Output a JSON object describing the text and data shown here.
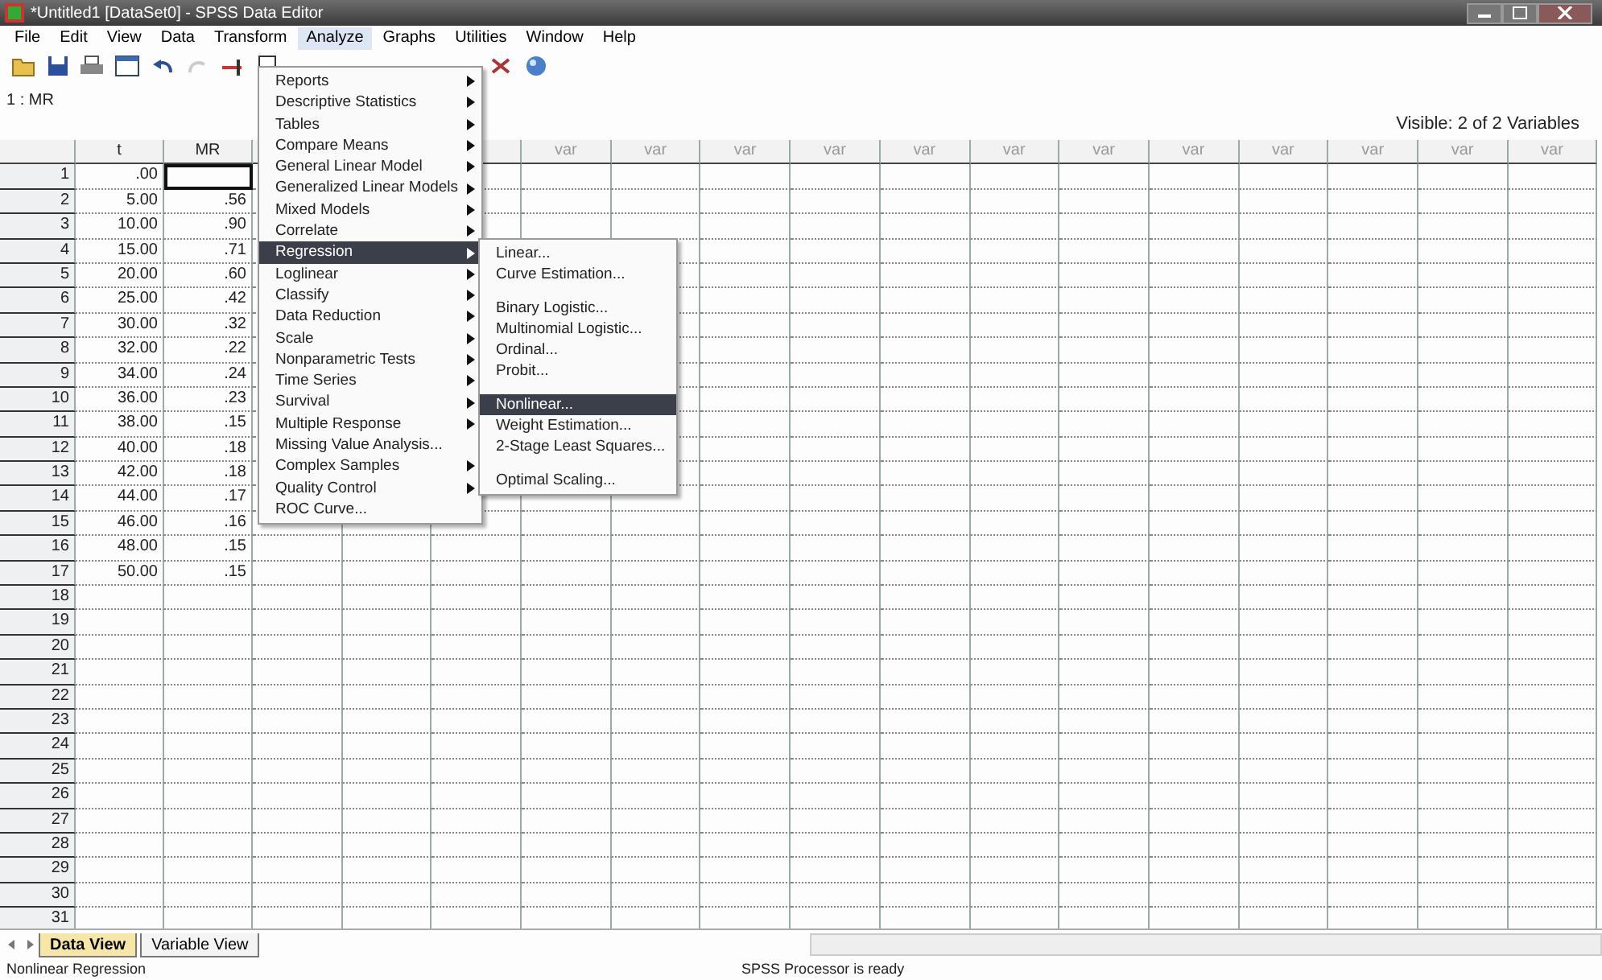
{
  "window": {
    "title": "*Untitled1 [DataSet0] - SPSS Data Editor"
  },
  "menu_bar": [
    {
      "label": "File",
      "selected": false
    },
    {
      "label": "Edit",
      "selected": false
    },
    {
      "label": "View",
      "selected": false
    },
    {
      "label": "Data",
      "selected": false
    },
    {
      "label": "Transform",
      "selected": false
    },
    {
      "label": "Analyze",
      "selected": true
    },
    {
      "label": "Graphs",
      "selected": false
    },
    {
      "label": "Utilities",
      "selected": false
    },
    {
      "label": "Window",
      "selected": false
    },
    {
      "label": "Help",
      "selected": false
    }
  ],
  "cell_editor": {
    "cell": "1 : MR"
  },
  "visible_count": "Visible: 2 of 2 Variables",
  "table": {
    "columns": [
      "t",
      "MR"
    ],
    "var_columns": [
      "var",
      "var",
      "var",
      "var",
      "var",
      "var",
      "var",
      "var",
      "var",
      "var",
      "var",
      "var"
    ],
    "rows": [
      {
        "number": "1",
        "values": [
          ".00"
        ],
        "active": true
      },
      {
        "number": "2",
        "values": [
          "5.00",
          ".56"
        ],
        "active": false
      },
      {
        "number": "3",
        "values": [
          "10.00",
          ".90"
        ],
        "active": false
      },
      {
        "number": "4",
        "values": [
          "15.00",
          ".71"
        ],
        "active": false
      },
      {
        "number": "5",
        "values": [
          "20.00",
          ".60"
        ],
        "active": false
      },
      {
        "number": "6",
        "values": [
          "25.00",
          ".42"
        ],
        "active": false
      },
      {
        "number": "7",
        "values": [
          "30.00",
          ".32"
        ],
        "active": false
      },
      {
        "number": "8",
        "values": [
          "32.00",
          ".22"
        ],
        "active": false
      },
      {
        "number": "9",
        "values": [
          "34.00",
          ".24"
        ],
        "active": false
      },
      {
        "number": "10",
        "values": [
          "36.00",
          ".23"
        ],
        "active": false
      },
      {
        "number": "11",
        "values": [
          "38.00",
          ".15"
        ],
        "active": false
      },
      {
        "number": "12",
        "values": [
          "40.00",
          ".18"
        ],
        "active": false
      },
      {
        "number": "13",
        "values": [
          "42.00",
          ".18"
        ],
        "active": false
      },
      {
        "number": "14",
        "values": [
          "44.00",
          ".17"
        ],
        "active": false
      },
      {
        "number": "15",
        "values": [
          "46.00",
          ".16"
        ],
        "active": false
      },
      {
        "number": "16",
        "values": [
          "48.00",
          ".15"
        ],
        "active": false
      },
      {
        "number": "17",
        "values": [
          "50.00",
          ".15"
        ],
        "active": false
      },
      {
        "number": "18",
        "values": [],
        "active": false
      },
      {
        "number": "19",
        "values": [],
        "active": false
      },
      {
        "number": "20",
        "values": [],
        "active": false
      },
      {
        "number": "21",
        "values": [],
        "active": false
      },
      {
        "number": "22",
        "values": [],
        "active": false
      },
      {
        "number": "23",
        "values": [],
        "active": false
      },
      {
        "number": "24",
        "values": [],
        "active": false
      },
      {
        "number": "25",
        "values": [],
        "active": false
      },
      {
        "number": "26",
        "values": [],
        "active": false
      },
      {
        "number": "27",
        "values": [],
        "active": false
      },
      {
        "number": "28",
        "values": [],
        "active": false
      },
      {
        "number": "29",
        "values": [],
        "active": false
      },
      {
        "number": "30",
        "values": [],
        "active": false
      },
      {
        "number": "31",
        "values": [],
        "active": false
      }
    ]
  },
  "analyze_menu": {
    "items": [
      {
        "label": "Reports",
        "submenu": true,
        "selected": false
      },
      {
        "label": "Descriptive Statistics",
        "submenu": true,
        "selected": false
      },
      {
        "label": "Tables",
        "submenu": true,
        "selected": false
      },
      {
        "label": "Compare Means",
        "submenu": true,
        "selected": false
      },
      {
        "label": "General Linear Model",
        "submenu": true,
        "selected": false
      },
      {
        "label": "Generalized Linear Models",
        "submenu": true,
        "selected": false
      },
      {
        "label": "Mixed Models",
        "submenu": true,
        "selected": false
      },
      {
        "label": "Correlate",
        "submenu": true,
        "selected": false
      },
      {
        "label": "Regression",
        "submenu": true,
        "selected": true
      },
      {
        "label": "Loglinear",
        "submenu": true,
        "selected": false
      },
      {
        "label": "Classify",
        "submenu": true,
        "selected": false
      },
      {
        "label": "Data Reduction",
        "submenu": true,
        "selected": false
      },
      {
        "label": "Scale",
        "submenu": true,
        "selected": false
      },
      {
        "label": "Nonparametric Tests",
        "submenu": true,
        "selected": false
      },
      {
        "label": "Time Series",
        "submenu": true,
        "selected": false
      },
      {
        "label": "Survival",
        "submenu": true,
        "selected": false
      },
      {
        "label": "Multiple Response",
        "submenu": true,
        "selected": false
      },
      {
        "label": "Missing Value Analysis...",
        "submenu": false,
        "selected": false
      },
      {
        "label": "Complex Samples",
        "submenu": true,
        "selected": false
      },
      {
        "label": "Quality Control",
        "submenu": true,
        "selected": false
      },
      {
        "label": "ROC Curve...",
        "submenu": false,
        "selected": false
      }
    ]
  },
  "regression_submenu": {
    "items": [
      {
        "kind": "item",
        "label": "Linear...",
        "selected": false
      },
      {
        "kind": "item",
        "label": "Curve Estimation...",
        "selected": false
      },
      {
        "kind": "separator"
      },
      {
        "kind": "item",
        "label": "Binary Logistic...",
        "selected": false
      },
      {
        "kind": "item",
        "label": "Multinomial Logistic...",
        "selected": false
      },
      {
        "kind": "item",
        "label": "Ordinal...",
        "selected": false
      },
      {
        "kind": "item",
        "label": "Probit...",
        "selected": false
      },
      {
        "kind": "separator"
      },
      {
        "kind": "item",
        "label": "Nonlinear...",
        "selected": true
      },
      {
        "kind": "item",
        "label": "Weight Estimation...",
        "selected": false
      },
      {
        "kind": "item",
        "label": "2-Stage Least Squares...",
        "selected": false
      },
      {
        "kind": "separator"
      },
      {
        "kind": "item",
        "label": "Optimal Scaling...",
        "selected": false
      }
    ]
  },
  "sheet_tabs": [
    {
      "label": "Data View",
      "selected": true
    },
    {
      "label": "Variable View",
      "selected": false
    }
  ],
  "status_bar": {
    "left": "Nonlinear Regression",
    "right": "SPSS Processor is ready"
  }
}
